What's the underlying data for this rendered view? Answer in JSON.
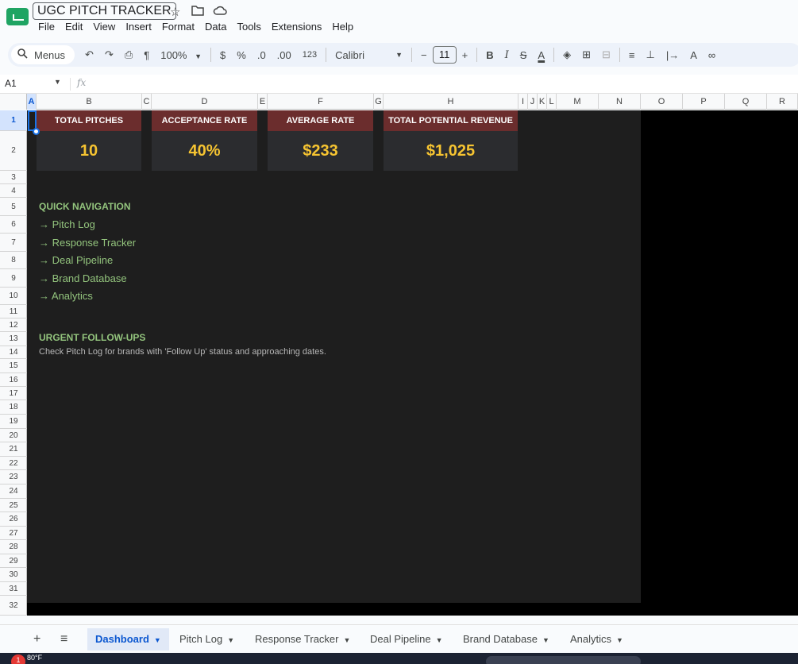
{
  "app": {
    "doc_title": "UGC PITCH TRACKER",
    "menu": [
      "File",
      "Edit",
      "View",
      "Insert",
      "Format",
      "Data",
      "Tools",
      "Extensions",
      "Help"
    ]
  },
  "toolbar": {
    "menus_label": "Menus",
    "zoom": "100%",
    "currency": "$",
    "percent": "%",
    "dec_decrease": ".0",
    "dec_increase": ".00",
    "number_format": "123",
    "font": "Calibri",
    "font_size": "11",
    "minus": "−",
    "plus": "+",
    "bold": "B",
    "italic": "I"
  },
  "formula_bar": {
    "name_box": "A1",
    "fx": "fx",
    "content": ""
  },
  "columns": [
    "A",
    "B",
    "C",
    "D",
    "E",
    "F",
    "G",
    "H",
    "I",
    "J",
    "K",
    "L",
    "M",
    "N",
    "O",
    "P",
    "Q",
    "R"
  ],
  "rows": [
    "1",
    "2",
    "3",
    "4",
    "5",
    "6",
    "7",
    "8",
    "9",
    "10",
    "11",
    "12",
    "13",
    "14",
    "15",
    "16",
    "17",
    "18",
    "19",
    "20",
    "21",
    "22",
    "23",
    "24",
    "25",
    "26",
    "27",
    "28",
    "29",
    "30",
    "31",
    "32"
  ],
  "metrics": [
    {
      "label": "TOTAL PITCHES",
      "value": "10"
    },
    {
      "label": "ACCEPTANCE RATE",
      "value": "40%"
    },
    {
      "label": "AVERAGE RATE",
      "value": "$233"
    },
    {
      "label": "TOTAL POTENTIAL REVENUE",
      "value": "$1,025"
    }
  ],
  "quick_nav": {
    "title": "QUICK NAVIGATION",
    "links": [
      "→ Pitch Log",
      "→ Response Tracker",
      "→ Deal Pipeline",
      "→ Brand Database",
      "→ Analytics"
    ]
  },
  "urgent": {
    "title": "URGENT FOLLOW-UPS",
    "text": "Check Pitch Log for brands with 'Follow Up' status and approaching dates."
  },
  "sheets": {
    "add": "+",
    "all": "≡",
    "tabs": [
      "Dashboard",
      "Pitch Log",
      "Response Tracker",
      "Deal Pipeline",
      "Brand Database",
      "Analytics"
    ],
    "active": "Dashboard"
  },
  "taskbar": {
    "notif": "1",
    "temp": "80°F"
  }
}
